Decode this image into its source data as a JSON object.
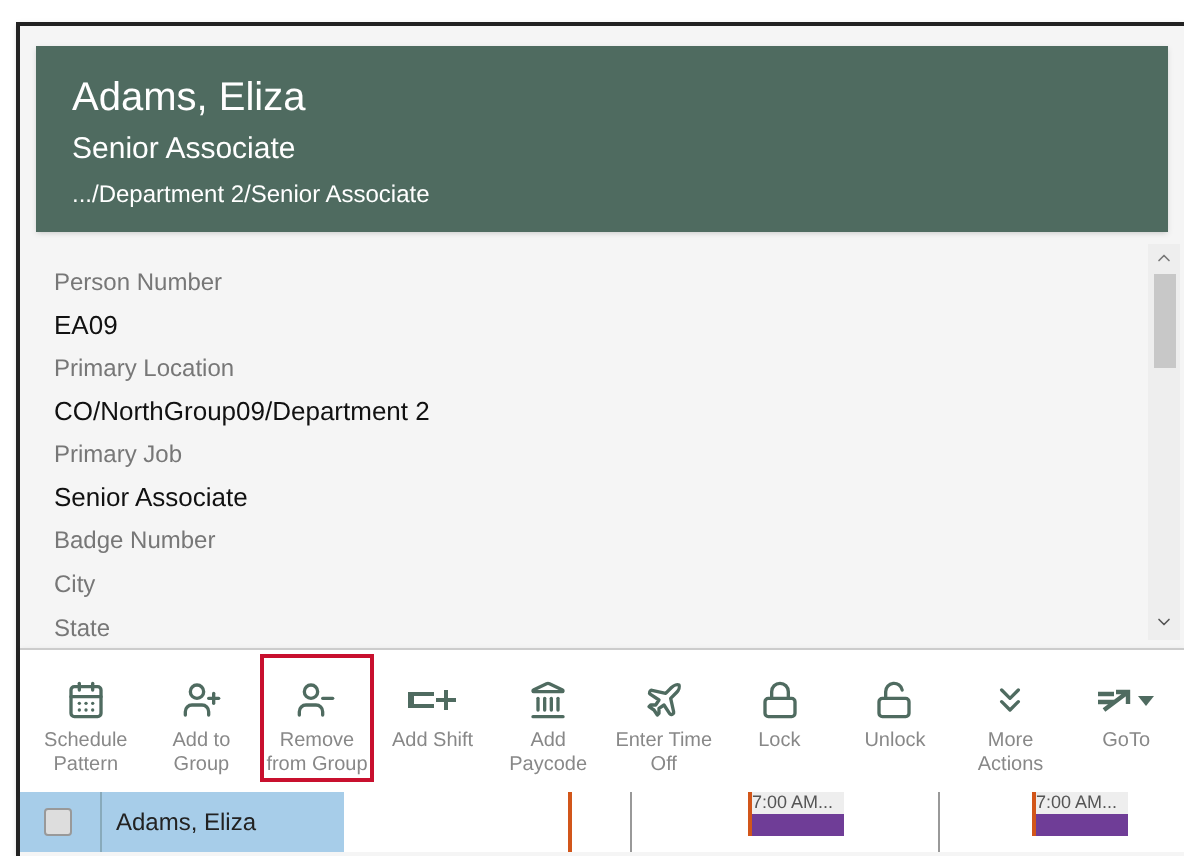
{
  "header": {
    "name": "Adams, Eliza",
    "job": "Senior Associate",
    "path": ".../Department 2/Senior Associate"
  },
  "details": [
    {
      "label": "Person Number",
      "value": "EA09"
    },
    {
      "label": "Primary Location",
      "value": "CO/NorthGroup09/Department 2"
    },
    {
      "label": "Primary Job",
      "value": "Senior Associate"
    },
    {
      "label": "Badge Number"
    },
    {
      "label": "City"
    },
    {
      "label": "State"
    }
  ],
  "toolbar": [
    {
      "kind": "calendar",
      "label": "Schedule Pattern",
      "highlighted": false
    },
    {
      "kind": "user-plus",
      "label": "Add to Group",
      "highlighted": false
    },
    {
      "kind": "user-minus",
      "label": "Remove from Group",
      "highlighted": true
    },
    {
      "kind": "shift",
      "label": "Add Shift",
      "highlighted": false
    },
    {
      "kind": "paycode",
      "label": "Add Paycode",
      "highlighted": false
    },
    {
      "kind": "timeoff",
      "label": "Enter Time Off",
      "highlighted": false
    },
    {
      "kind": "lock",
      "label": "Lock",
      "highlighted": false
    },
    {
      "kind": "unlock",
      "label": "Unlock",
      "highlighted": false
    },
    {
      "kind": "more",
      "label": "More Actions",
      "highlighted": false
    },
    {
      "kind": "goto",
      "label": "GoTo",
      "highlighted": false
    }
  ],
  "schedule_row": {
    "employee": "Adams, Eliza",
    "checked": false,
    "shifts": [
      "7:00 AM...",
      "7:00 AM..."
    ]
  }
}
